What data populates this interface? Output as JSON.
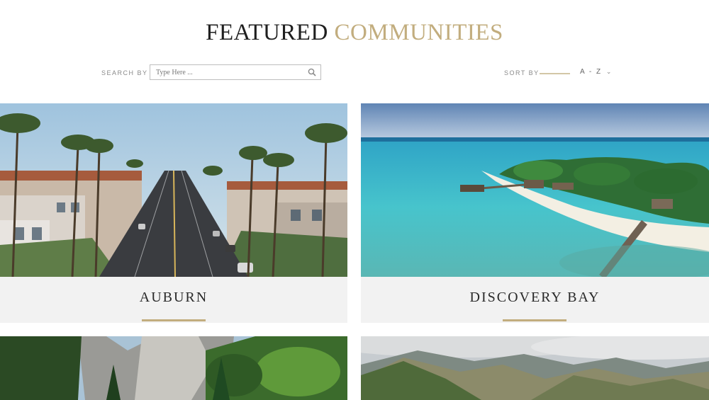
{
  "header": {
    "title_part1": "FEATURED",
    "title_part2": "COMMUNITIES"
  },
  "search": {
    "label": "SEARCH BY",
    "placeholder": "Type Here ..."
  },
  "sort": {
    "label": "SORT BY",
    "value": "A - Z"
  },
  "colors": {
    "accent_gold": "#c2ad7e",
    "card_background": "#f2f2f2"
  },
  "communities": [
    {
      "name": "AUBURN"
    },
    {
      "name": "DISCOVERY BAY"
    }
  ]
}
